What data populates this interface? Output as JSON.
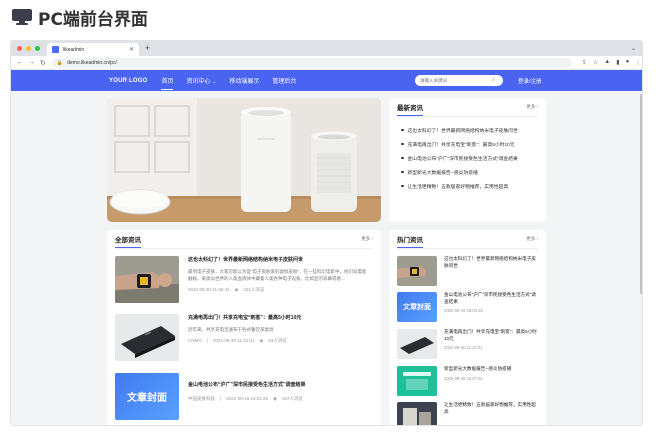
{
  "doc": {
    "title": "PC端前台界面"
  },
  "browser": {
    "tab_title": "likeadmin",
    "url": "demo.likeadmin.cn/pc/",
    "new_tab": "+"
  },
  "site": {
    "logo": "YOUR LOGO",
    "nav": [
      "首页",
      "资讯中心",
      "移动端展示",
      "管理后台"
    ],
    "search_placeholder": "请输入关键词",
    "login": "登录/注册"
  },
  "latest": {
    "title": "最新资讯",
    "more": "更多 ›",
    "items": [
      "这也太科幻了！世界最新网络结构纳米电子皮肤问世",
      "充满电再出门！共享充电宝“刺客”：最高5小时10元",
      "金山电池公布“沪广”深市民接受色生活方式”调查结果",
      "新型新光大数据报告--感炎防疫播",
      "让生活更精致！五款居家好物推荐，实用性超高"
    ]
  },
  "all_news": {
    "title": "全部资讯",
    "more": "更多 ›",
    "items": [
      {
        "title": "这也太科幻了！世界最新网络结构纳米电子皮肤问世",
        "desc": "最到电子皮肤，大家可能以为是“电子皮肤爱的虚拟皮肤”，在一些科幻电影中，他们穿着能触碰、来类似世界的人类血液体中藏着人类各种电子设备，比如显示屏幕或者…",
        "date": "2022-09-30 11:36:42",
        "views": "221人浏览"
      },
      {
        "title": "充满电再出门！共享充电宝“刺客”：最高5小时10元",
        "desc": "近年来，共享充电宝遍布于各式餐饮某类场",
        "source": "CNMO",
        "date": "2022-09-30 11:32:01",
        "views": "63人浏览"
      },
      {
        "title": "金山电池公布“沪广”深市民接受色生活方式”调查结果",
        "desc": "",
        "source": "中国皮肤科技",
        "date": "2022-09-16 16:04:25",
        "views": "107人浏览",
        "cover_label": "文章封面"
      }
    ]
  },
  "hot": {
    "title": "热门资讯",
    "more": "更多 ›",
    "items": [
      {
        "title": "这也太科幻了！世界最新网络结构纳米电子皮肤问世",
        "date": ""
      },
      {
        "title": "金山电池公布“沪广”深市民接受色生活方式”调查结果",
        "date": "2022-09-16 16:04:25",
        "cover_label": "文章封面"
      },
      {
        "title": "充满电再出门！共享充电宝“刺客”：最高5小时10元",
        "date": "2022-09-30 11:32:01"
      },
      {
        "title": "新型新光大数据报告--感炎防疫播",
        "date": "2022-09-30 16:07:54"
      },
      {
        "title": "让生活更精致！五款居家好物推荐，实用性超高",
        "date": ""
      }
    ]
  }
}
